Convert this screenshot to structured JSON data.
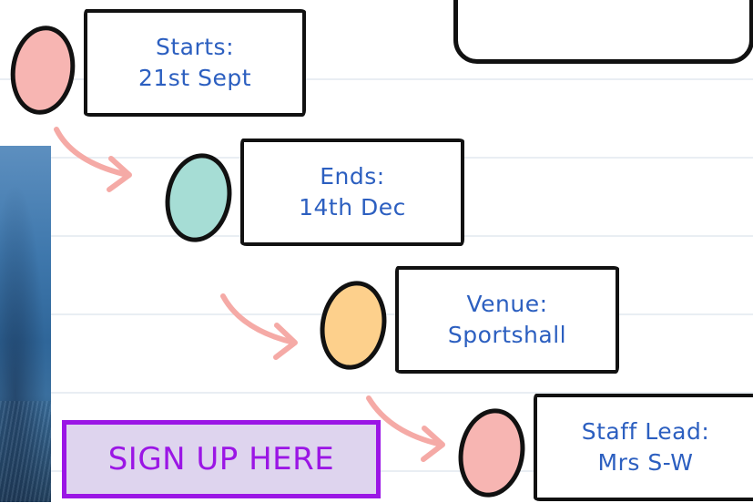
{
  "steps": [
    {
      "label": "Starts:",
      "value": "21st Sept",
      "dot_color": "#f7b5b2"
    },
    {
      "label": "Ends:",
      "value": "14th Dec",
      "dot_color": "#a6ddd5"
    },
    {
      "label": "Venue:",
      "value": "Sportshall",
      "dot_color": "#fdd08c"
    },
    {
      "label": "Staff Lead:",
      "value": "Mrs S-W",
      "dot_color": "#f7b5b2"
    }
  ],
  "signup": {
    "label": "SIGN UP HERE"
  },
  "colors": {
    "text": "#2c5fc0",
    "arrow": "#f5aaa6",
    "button_border": "#9b16e5",
    "button_fill": "#ded4ee"
  }
}
